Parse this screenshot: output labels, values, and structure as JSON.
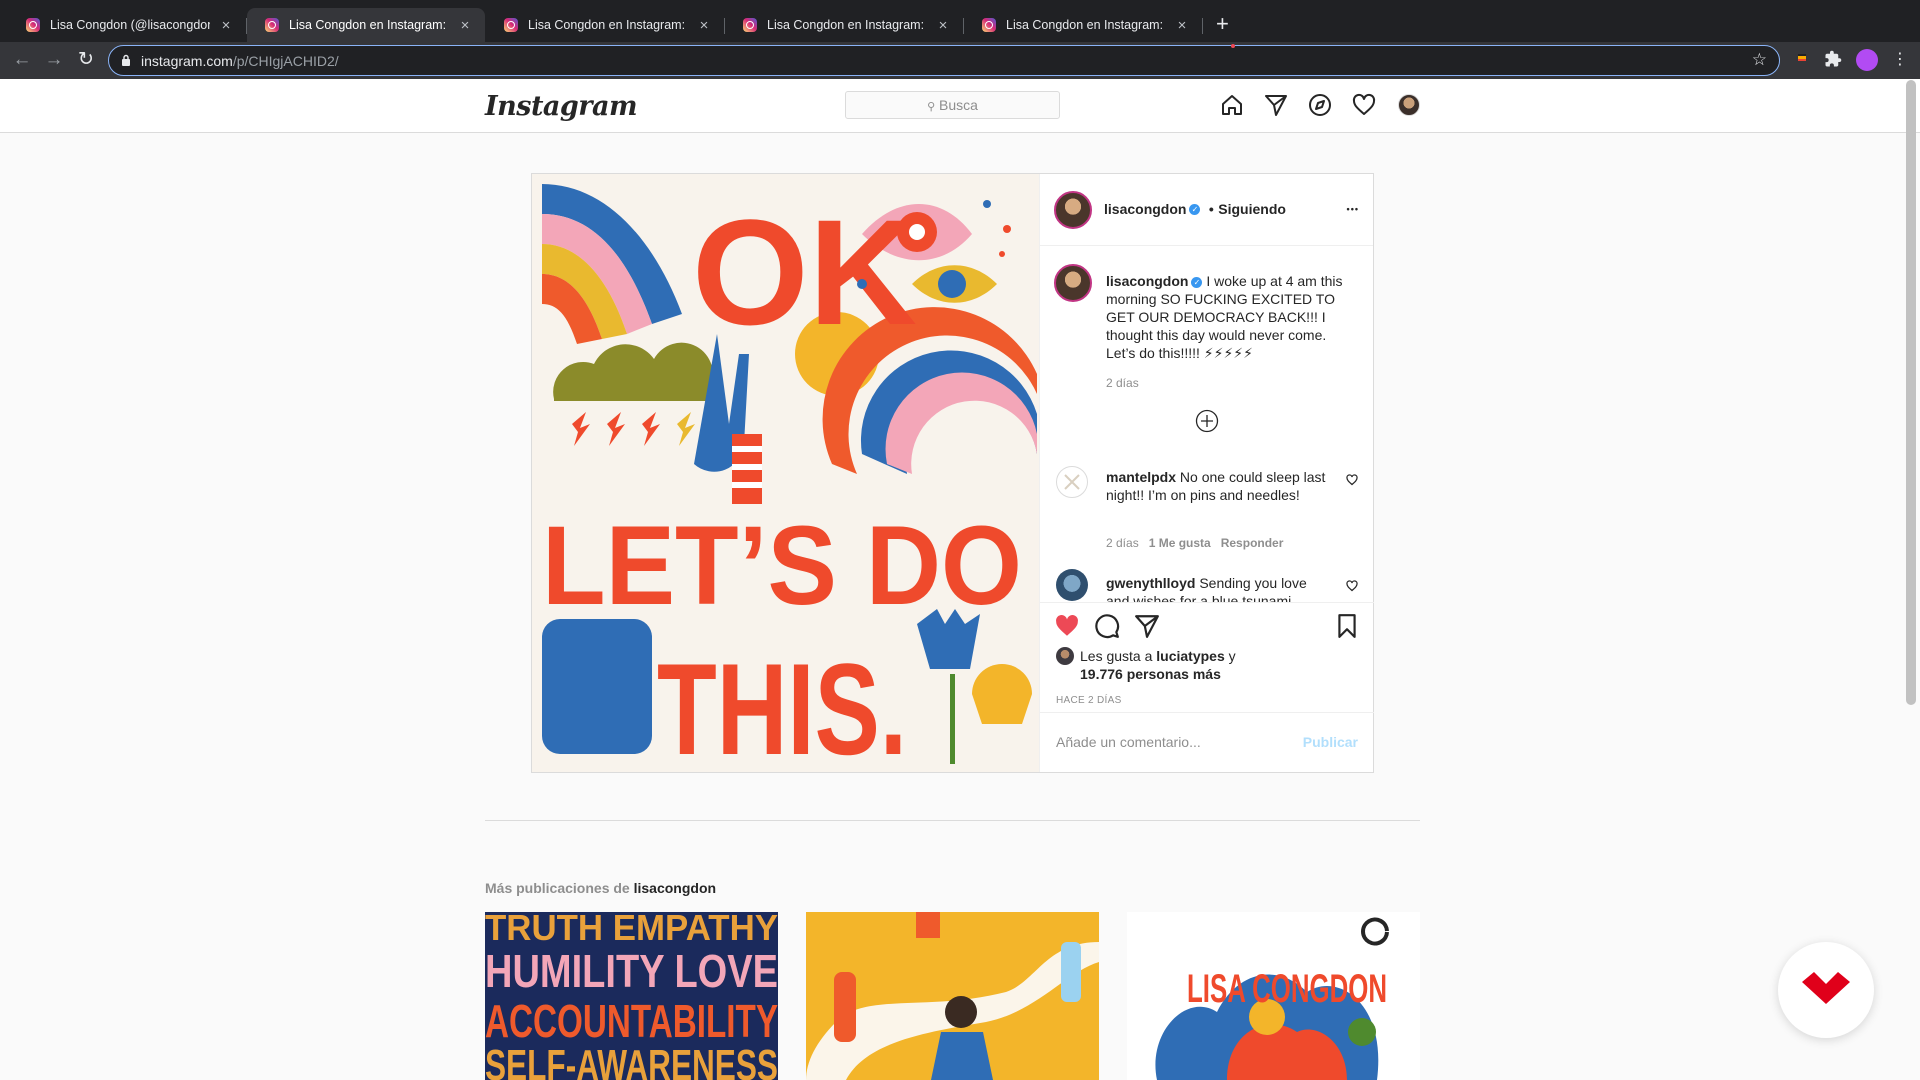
{
  "browser": {
    "tabs": [
      {
        "title": "Lisa Congdon (@lisacongdon)",
        "active": false
      },
      {
        "title": "Lisa Congdon en Instagram: \"I",
        "active": true
      },
      {
        "title": "Lisa Congdon en Instagram: \"T",
        "active": false
      },
      {
        "title": "Lisa Congdon en Instagram: \"I",
        "active": false
      },
      {
        "title": "Lisa Congdon en Instagram: \"C",
        "active": false
      }
    ],
    "tab_close_glyph": "×",
    "new_tab_glyph": "+",
    "url_host": "instagram.com",
    "url_path": "/p/CHIgjACHID2/"
  },
  "instagram": {
    "logo": "Instagram",
    "search_placeholder": "Busca",
    "nav_icons": [
      "home-icon",
      "direct-icon",
      "explore-icon",
      "activity-heart-icon",
      "profile-avatar"
    ]
  },
  "post": {
    "header": {
      "username": "lisacongdon",
      "separator": "•",
      "follow_status": "Siguiendo",
      "more": "•••"
    },
    "caption": {
      "username": "lisacongdon",
      "text": "I woke up at 4 am this morning SO FUCKING EXCITED TO GET OUR DEMOCRACY BACK!!! I thought this day would never come. Let’s do this!!!!! ⚡⚡⚡⚡⚡",
      "time": "2 días"
    },
    "comments": [
      {
        "username": "mantelpdx",
        "text": "No one could sleep last night!! I’m on pins and needles!",
        "time": "2 días",
        "likes": "1 Me gusta",
        "reply": "Responder"
      },
      {
        "username": "gwenythlloyd",
        "text": "Sending you love and wishes for a blue tsunami"
      }
    ],
    "likes": {
      "prefix": "Les gusta a",
      "user": "luciatypes",
      "joiner": "y",
      "others": "19.776 personas más"
    },
    "timestamp": "HACE 2 DÍAS",
    "comment_placeholder": "Añade un comentario...",
    "publish": "Publicar",
    "artwork_text": {
      "line1": "OK",
      "line2": "LET’S DO",
      "line3": "THIS."
    }
  },
  "more_posts": {
    "label": "Más publicaciones de",
    "username": "lisacongdon",
    "thumbs": [
      {
        "lines": [
          "TRUTH EMPATHY",
          "HUMILITY LOVE",
          "ACCOUNTABILITY",
          "SELF-AWARENESS"
        ]
      },
      {
        "lines": []
      },
      {
        "lines": [
          "LISA CONGDON"
        ]
      }
    ]
  },
  "colors": {
    "accent_blue": "#3897f0",
    "like_red": "#ed4956",
    "publish_disabled": "#b2dffc",
    "browser_dark": "#202124",
    "widget_red": "#e0001a"
  }
}
